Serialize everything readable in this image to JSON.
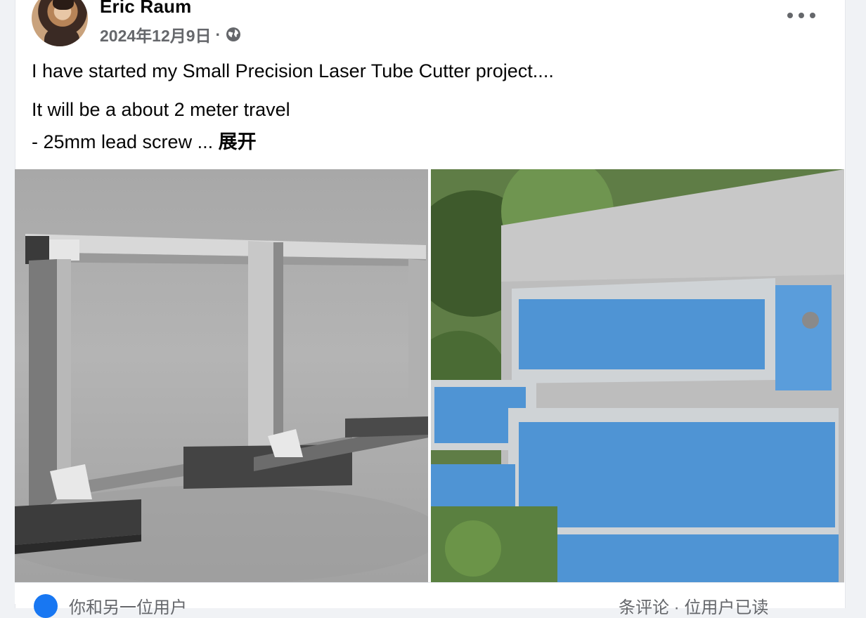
{
  "post": {
    "author": "Eric Raum",
    "date": "2024年12月9日",
    "separator": "·",
    "privacy_icon": "globe-icon",
    "more_icon": "more-horizontal-icon",
    "text_line_1": "I have started my Small Precision Laser Tube Cutter project....",
    "text_line_2": "It will be a about 2 meter travel",
    "text_line_3": "- 25mm lead screw ...",
    "see_more": "展开"
  },
  "footer": {
    "reactions_text": "你和另一位用户",
    "comments_text": "条评论 · 位用户已读"
  },
  "colors": {
    "secondary_text": "#65676b",
    "primary_text": "#050505",
    "brand_blue": "#1877f2",
    "card_bg": "#ffffff",
    "page_bg": "#f0f2f5"
  }
}
